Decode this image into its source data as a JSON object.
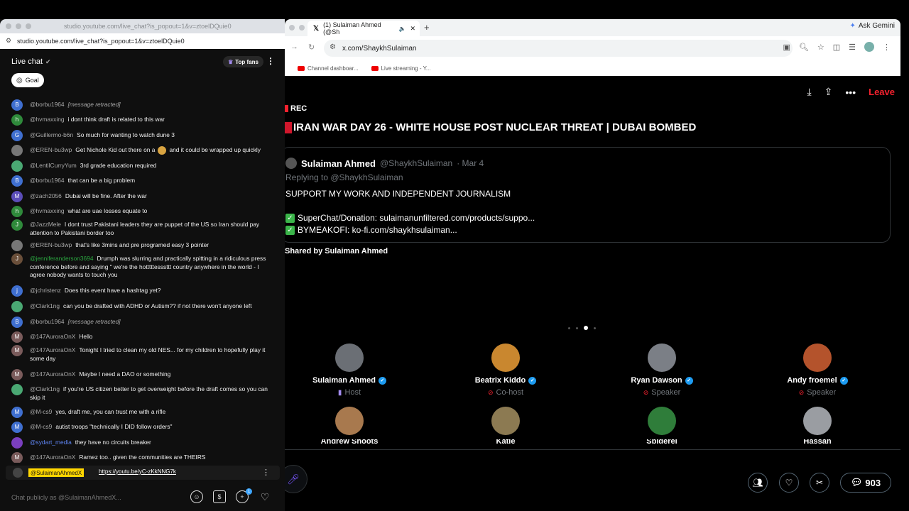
{
  "yt_popout": {
    "tab_url": "studio.youtube.com/live_chat?is_popout=1&v=ztoelDQuie0",
    "address": "studio.youtube.com/live_chat?is_popout=1&v=ztoelDQuie0",
    "header_title": "Live chat",
    "top_fans_label": "Top fans",
    "goal_label": "Goal",
    "messages": [
      {
        "initial": "B",
        "avatar_color": "#3f6fd0",
        "author": "@borbu1964",
        "text": "[message retracted]",
        "retracted": true
      },
      {
        "initial": "h",
        "avatar_color": "#2f8a3b",
        "author": "@hvmaxxing",
        "text": "i dont think draft is related to this war"
      },
      {
        "initial": "G",
        "avatar_color": "#3f6fd0",
        "author": "@Guillermo-b6n",
        "text": "So much for wanting to watch dune 3"
      },
      {
        "initial": "",
        "avatar_color": "#777",
        "author": "@EREN-bu3wp",
        "text": "Get Nichole Kid out there on a",
        "text2": "and it could be wrapped up quickly"
      },
      {
        "initial": "",
        "avatar_color": "#4aa873",
        "author": "@LentilCurryYum",
        "text": "3rd grade education required"
      },
      {
        "initial": "B",
        "avatar_color": "#3f6fd0",
        "author": "@borbu1964",
        "text": "that can be a big problem"
      },
      {
        "initial": "M",
        "avatar_color": "#5b4db8",
        "author": "@zach2056",
        "text": "Dubai will be fine. After the war"
      },
      {
        "initial": "h",
        "avatar_color": "#2f8a3b",
        "author": "@hvmaxxing",
        "text": "what are uae losses equate to"
      },
      {
        "initial": "J",
        "avatar_color": "#2f8a3b",
        "author": "@JazzMele",
        "text": "I dont trust Pakistani leaders they are puppet of the US so Iran should pay attention to Pakistani border too"
      },
      {
        "initial": "",
        "avatar_color": "#777",
        "author": "@EREN-bu3wp",
        "text": "that's like 3mins and pre programed easy 3 pointer"
      },
      {
        "initial": "J",
        "avatar_color": "#6a4f3a",
        "author": "@jenniferanderson3694",
        "text": "Drumph was slurring and practically spitting in a ridiculous press conference before and saying \" we're the hotttttesssttt country anywhere in the world - I agree nobody wants to touch you"
      },
      {
        "initial": "j",
        "avatar_color": "#3f6fd0",
        "author": "@jchristenz",
        "text": "Does this event have a hashtag yet?"
      },
      {
        "initial": "",
        "avatar_color": "#4aa873",
        "author": "@Clark1ng",
        "text": "can you be drafted with ADHD or Autism?? if not there won't anyone left"
      },
      {
        "initial": "B",
        "avatar_color": "#3f6fd0",
        "author": "@borbu1964",
        "text": "[message retracted]",
        "retracted": true
      },
      {
        "initial": "M",
        "avatar_color": "#7a5b5b",
        "author": "@147AuroraOnX",
        "text": "Hello"
      },
      {
        "initial": "M",
        "avatar_color": "#7a5b5b",
        "author": "@147AuroraOnX",
        "text": "Tonight I tried to clean my old NES... for my children to hopefully play it some day"
      },
      {
        "initial": "M",
        "avatar_color": "#7a5b5b",
        "author": "@147AuroraOnX",
        "text": "Maybe I need a DAO or something"
      },
      {
        "initial": "",
        "avatar_color": "#4aa873",
        "author": "@Clark1ng",
        "text": "if you're US citizen better to get overweight before the draft comes so you can skip it"
      },
      {
        "initial": "M",
        "avatar_color": "#3f6fd0",
        "author": "@M-cs9",
        "text": "yes, draft me, you can trust me with a rifle"
      },
      {
        "initial": "M",
        "avatar_color": "#3f6fd0",
        "author": "@M-cs9",
        "text": "autist troops \"technically I DID follow orders\""
      },
      {
        "initial": "",
        "avatar_color": "#7b3fbf",
        "author": "@sydart_media",
        "text": "they have no circuits breaker"
      },
      {
        "initial": "M",
        "avatar_color": "#7a5b5b",
        "author": "@147AuroraOnX",
        "text": "Ramez too.. given the communities are THEIRS"
      }
    ],
    "pinned_author": "@SulaimanAhmedX",
    "pinned_link": "https://youtu.be/yC-zKkNNG7k",
    "input_placeholder": "Chat publicly as @SulaimanAhmedX...",
    "plus_badge": "1"
  },
  "x_browser": {
    "tab_title": "(1) Sulaiman Ahmed (@Sh",
    "ask_gemini": "Ask Gemini",
    "url": "x.com/ShaykhSulaiman",
    "bookmarks": [
      "Channel dashboar...",
      "Live streaming - Y..."
    ]
  },
  "space": {
    "leave_label": "Leave",
    "rec_label": "REC",
    "title": "IRAN WAR DAY 26 - WHITE HOUSE POST NUCLEAR THREAT | DUBAI BOMBED",
    "tweet": {
      "name": "Sulaiman Ahmed",
      "handle": "@ShaykhSulaiman",
      "date": "· Mar 4",
      "replying": "Replying to @ShaykhSulaiman",
      "line1": "SUPPORT MY WORK AND INDEPENDENT JOURNALISM",
      "line2": "SuperChat/Donation: sulaimanunfiltered.com/products/suppo...",
      "line3": "BYMEAKOFI: ko-fi.com/shaykhsulaiman..."
    },
    "shared_by": "Shared by Sulaiman Ahmed",
    "participants": [
      {
        "name": "Sulaiman Ahmed",
        "role": "Host",
        "color": "#6b6f75"
      },
      {
        "name": "Beatrix Kiddo",
        "role": "Co-host",
        "color": "#c9872f"
      },
      {
        "name": "Ryan Dawson",
        "role": "Speaker",
        "color": "#7b7f86"
      },
      {
        "name": "Andy froemel",
        "role": "Speaker",
        "color": "#b4532c"
      },
      {
        "name": "Andrew Shoots",
        "role": "",
        "color": "#a8794e"
      },
      {
        "name": "Katie",
        "role": "",
        "color": "#8c7a52"
      },
      {
        "name": "Spiderel",
        "role": "",
        "color": "#2f7d3a"
      },
      {
        "name": "Hassan",
        "role": "",
        "color": "#9a9da2"
      }
    ],
    "listener_count": "903"
  }
}
